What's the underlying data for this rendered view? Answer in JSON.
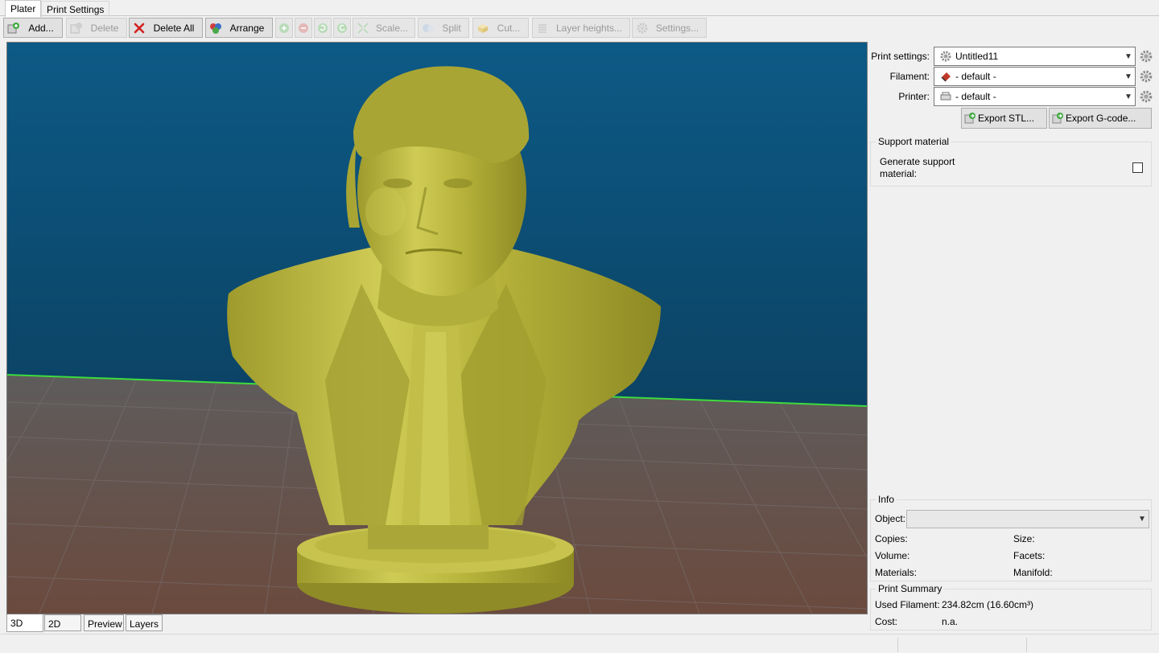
{
  "tabs": [
    "Plater",
    "Print Settings"
  ],
  "toolbar": {
    "add": "Add...",
    "delete": "Delete",
    "delete_all": "Delete All",
    "arrange": "Arrange",
    "scale": "Scale...",
    "split": "Split",
    "cut": "Cut...",
    "layer_heights": "Layer heights...",
    "settings": "Settings..."
  },
  "view_tabs": [
    "3D",
    "2D",
    "Preview",
    "Layers"
  ],
  "presets": {
    "print_label": "Print settings:",
    "print_value": "Untitled11",
    "filament_label": "Filament:",
    "filament_value": "- default -",
    "printer_label": "Printer:",
    "printer_value": "- default -"
  },
  "export": {
    "stl": "Export STL...",
    "gcode": "Export G-code..."
  },
  "support": {
    "title": "Support material",
    "generate_line1": "Generate support",
    "generate_line2": "material:"
  },
  "info": {
    "title": "Info",
    "object_label": "Object:",
    "copies": "Copies:",
    "volume": "Volume:",
    "materials": "Materials:",
    "size": "Size:",
    "facets": "Facets:",
    "manifold": "Manifold:"
  },
  "summary": {
    "title": "Print Summary",
    "used_filament_label": "Used Filament:",
    "used_filament_value": "234.82cm (16.60cm³)",
    "cost_label": "Cost:",
    "cost_value": "n.a."
  },
  "colors": {
    "sky_top": "#0d5a86",
    "sky_bottom": "#0a3550",
    "floor_top": "#5e5c5c",
    "floor_bottom": "#6b4a3e",
    "model": "#b8b43c",
    "horizon": "#3ddc3d"
  }
}
